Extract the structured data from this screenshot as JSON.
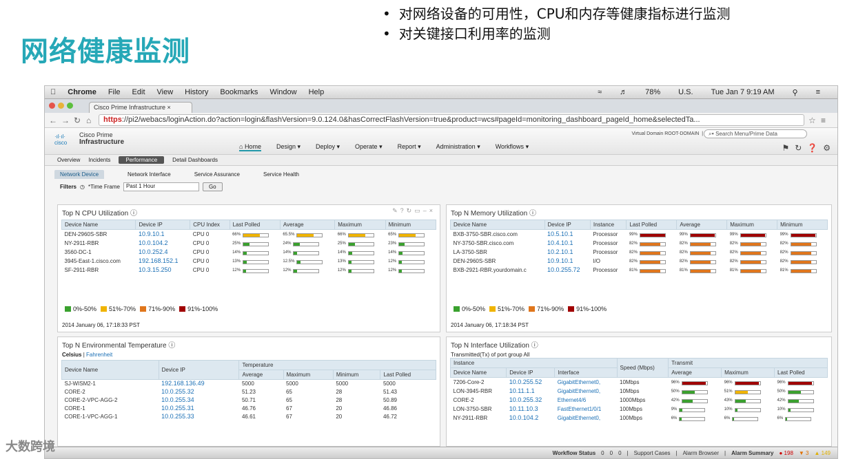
{
  "slide": {
    "title": "网络健康监测",
    "bullets": [
      "对网络设备的可用性，CPU和内存等健康指标进行监测",
      "对关键接口利用率的监测"
    ]
  },
  "mac": {
    "app": "Chrome",
    "menus": [
      "File",
      "Edit",
      "View",
      "History",
      "Bookmarks",
      "Window",
      "Help"
    ],
    "battery": "78%",
    "flag": "U.S.",
    "clock": "Tue Jan 7  9:19 AM"
  },
  "browser": {
    "tab": "Cisco Prime Infrastructure",
    "url_scheme": "https",
    "url_rest": "://pi2/webacs/loginAction.do?action=login&flashVersion=9.0.124.0&hasCorrectFlashVersion=true&product=wcs#pageId=monitoring_dashboard_pageId_home&selectedTa..."
  },
  "cisco": {
    "logo": "cisco",
    "brand_top": "Cisco Prime",
    "brand_bottom": "Infrastructure",
    "virtual_domain": "Virtual Domain ROOT-DOMAIN",
    "user": "prime",
    "search_placeholder": "Search Menu/Prime Data",
    "menu": [
      "Home",
      "Design",
      "Deploy",
      "Operate",
      "Report",
      "Administration",
      "Workflows"
    ]
  },
  "subnav": [
    "Overview",
    "Incidents",
    "Performance",
    "Detail Dashboards"
  ],
  "pagetabs": [
    "Network Device",
    "Network Interface",
    "Service Assurance",
    "Service Health"
  ],
  "filters": {
    "label": "Filters",
    "time_label": "*Time Frame",
    "time_value": "Past 1 Hour",
    "go": "Go"
  },
  "legend": [
    {
      "label": "0%-50%",
      "color": "#3aa12e"
    },
    {
      "label": "51%-70%",
      "color": "#f0b400"
    },
    {
      "label": "71%-90%",
      "color": "#e0761c"
    },
    {
      "label": "91%-100%",
      "color": "#a00000"
    }
  ],
  "cpu": {
    "title": "Top N CPU Utilization",
    "headers": [
      "Device Name",
      "Device IP",
      "CPU Index",
      "Last Polled",
      "Average",
      "Maximum",
      "Minimum"
    ],
    "rows": [
      {
        "name": "DEN-2960S-SBR",
        "ip": "10.9.10.1",
        "idx": "CPU 0",
        "vals": [
          "66%",
          "65.5%",
          "66%",
          "65%"
        ],
        "pct": [
          66,
          65.5,
          66,
          65
        ],
        "color": "#f0b400"
      },
      {
        "name": "NY-2911-RBR",
        "ip": "10.0.104.2",
        "idx": "CPU 0",
        "vals": [
          "25%",
          "24%",
          "25%",
          "23%"
        ],
        "pct": [
          25,
          24,
          25,
          23
        ],
        "color": "#3aa12e"
      },
      {
        "name": "3560-DC-1",
        "ip": "10.0.252.4",
        "idx": "CPU 0",
        "vals": [
          "14%",
          "14%",
          "14%",
          "14%"
        ],
        "pct": [
          14,
          14,
          14,
          14
        ],
        "color": "#3aa12e"
      },
      {
        "name": "3945-East-1.cisco.com",
        "ip": "192.168.152.1",
        "idx": "CPU 0",
        "vals": [
          "13%",
          "12.5%",
          "13%",
          "12%"
        ],
        "pct": [
          13,
          12.5,
          13,
          12
        ],
        "color": "#3aa12e"
      },
      {
        "name": "SF-2911-RBR",
        "ip": "10.3.15.250",
        "idx": "CPU 0",
        "vals": [
          "12%",
          "12%",
          "12%",
          "12%"
        ],
        "pct": [
          12,
          12,
          12,
          12
        ],
        "color": "#3aa12e"
      }
    ],
    "timestamp": "2014 January 06, 17:18:33 PST"
  },
  "mem": {
    "title": "Top N Memory Utilization",
    "headers": [
      "Device Name",
      "Device IP",
      "Instance",
      "Last Polled",
      "Average",
      "Maximum",
      "Minimum"
    ],
    "rows": [
      {
        "name": "BXB-3750-SBR.cisco.com",
        "ip": "10.5.10.1",
        "idx": "Processor",
        "vals": [
          "99%",
          "99%",
          "99%",
          "99%"
        ],
        "pct": [
          99,
          99,
          99,
          99
        ],
        "color": "#a00000"
      },
      {
        "name": "NY-3750-SBR.cisco.com",
        "ip": "10.4.10.1",
        "idx": "Processor",
        "vals": [
          "82%",
          "82%",
          "82%",
          "82%"
        ],
        "pct": [
          82,
          82,
          82,
          82
        ],
        "color": "#e0761c"
      },
      {
        "name": "LA-3750-SBR",
        "ip": "10.2.10.1",
        "idx": "Processor",
        "vals": [
          "82%",
          "82%",
          "82%",
          "82%"
        ],
        "pct": [
          82,
          82,
          82,
          82
        ],
        "color": "#e0761c"
      },
      {
        "name": "DEN-2960S-SBR",
        "ip": "10.9.10.1",
        "idx": "I/O",
        "vals": [
          "82%",
          "82%",
          "82%",
          "82%"
        ],
        "pct": [
          82,
          82,
          82,
          82
        ],
        "color": "#e0761c"
      },
      {
        "name": "BXB-2921-RBR.yourdomain.c",
        "ip": "10.0.255.72",
        "idx": "Processor",
        "vals": [
          "81%",
          "81%",
          "81%",
          "81%"
        ],
        "pct": [
          81,
          81,
          81,
          81
        ],
        "color": "#e0761c"
      }
    ],
    "timestamp": "2014 January 06, 17:18:34 PST"
  },
  "env": {
    "title": "Top N Environmental Temperature",
    "units": [
      "Celsius",
      "Fahrenheit"
    ],
    "group": "Temperature",
    "headers": [
      "Device Name",
      "Device IP",
      "Average",
      "Maximum",
      "Minimum",
      "Last Polled"
    ],
    "rows": [
      [
        "SJ-WISM2-1",
        "192.168.136.49",
        "5000",
        "5000",
        "5000",
        "5000"
      ],
      [
        "CORE-2",
        "10.0.255.32",
        "51.23",
        "65",
        "28",
        "51.43"
      ],
      [
        "CORE-2-VPC-AGG-2",
        "10.0.255.34",
        "50.71",
        "65",
        "28",
        "50.89"
      ],
      [
        "CORE-1",
        "10.0.255.31",
        "46.76",
        "67",
        "20",
        "46.86"
      ],
      [
        "CORE-1-VPC-AGG-1",
        "10.0.255.33",
        "46.61",
        "67",
        "20",
        "46.72"
      ]
    ]
  },
  "iface": {
    "title": "Top N Interface Utilization",
    "subtitle": "Transmitted(Tx) of port group All",
    "group_instance": "Instance",
    "group_tx": "Transmit",
    "headers": [
      "Device Name",
      "Device IP",
      "Interface",
      "Speed (Mbps)",
      "Average",
      "Maximum",
      "Last Polled"
    ],
    "rows": [
      {
        "name": "7206-Core-2",
        "ip": "10.0.255.52",
        "iface": "GigabitEthernet0,",
        "speed": "10Mbps",
        "vals": [
          "96%",
          "96%",
          "96%"
        ],
        "pct": [
          96,
          96,
          96
        ],
        "colors": [
          "#a00000",
          "#a00000",
          "#a00000"
        ]
      },
      {
        "name": "LON-3945-RBR",
        "ip": "10.11.1.1",
        "iface": "GigabitEthernet0,",
        "speed": "10Mbps",
        "vals": [
          "50%",
          "51%",
          "50%"
        ],
        "pct": [
          50,
          51,
          50
        ],
        "colors": [
          "#3aa12e",
          "#f0b400",
          "#3aa12e"
        ]
      },
      {
        "name": "CORE-2",
        "ip": "10.0.255.32",
        "iface": "Ethernet4/6",
        "speed": "1000Mbps",
        "vals": [
          "42%",
          "43%",
          "42%"
        ],
        "pct": [
          42,
          43,
          42
        ],
        "colors": [
          "#3aa12e",
          "#3aa12e",
          "#3aa12e"
        ]
      },
      {
        "name": "LON-3750-SBR",
        "ip": "10.11.10.3",
        "iface": "FastEthernet1/0/1",
        "speed": "100Mbps",
        "vals": [
          "9%",
          "10%",
          "10%"
        ],
        "pct": [
          9,
          10,
          10
        ],
        "colors": [
          "#3aa12e",
          "#3aa12e",
          "#3aa12e"
        ]
      },
      {
        "name": "NY-2911-RBR",
        "ip": "10.0.104.2",
        "iface": "GigabitEthernet0,",
        "speed": "100Mbps",
        "vals": [
          "6%",
          "6%",
          "6%"
        ],
        "pct": [
          6,
          6,
          6
        ],
        "colors": [
          "#3aa12e",
          "#3aa12e",
          "#3aa12e"
        ]
      }
    ]
  },
  "status": {
    "workflow": "Workflow Status",
    "counts": [
      "0",
      "0",
      "0"
    ],
    "support": "Support Cases",
    "alarm_browser": "Alarm Browser",
    "alarm_summary": "Alarm Summary",
    "critical": "198",
    "major": "3",
    "minor": "149"
  },
  "watermark": "大数跨境"
}
